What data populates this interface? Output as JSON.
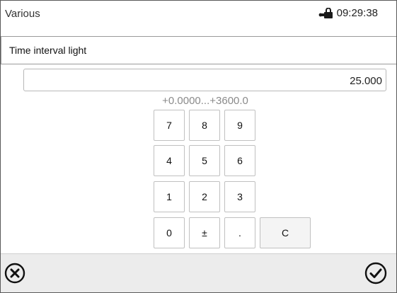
{
  "header": {
    "title": "Various",
    "lock_icon": "lock-icon",
    "time": "09:29:38"
  },
  "dialog": {
    "title": "Time interval light",
    "value": "25.000",
    "range": "+0.0000...+3600.0"
  },
  "keypad": {
    "keys": [
      "7",
      "8",
      "9",
      "4",
      "5",
      "6",
      "1",
      "2",
      "3",
      "0",
      "±",
      ".",
      "C"
    ]
  },
  "footer": {
    "cancel_icon": "cancel-circle-x-icon",
    "confirm_icon": "confirm-circle-check-icon"
  }
}
